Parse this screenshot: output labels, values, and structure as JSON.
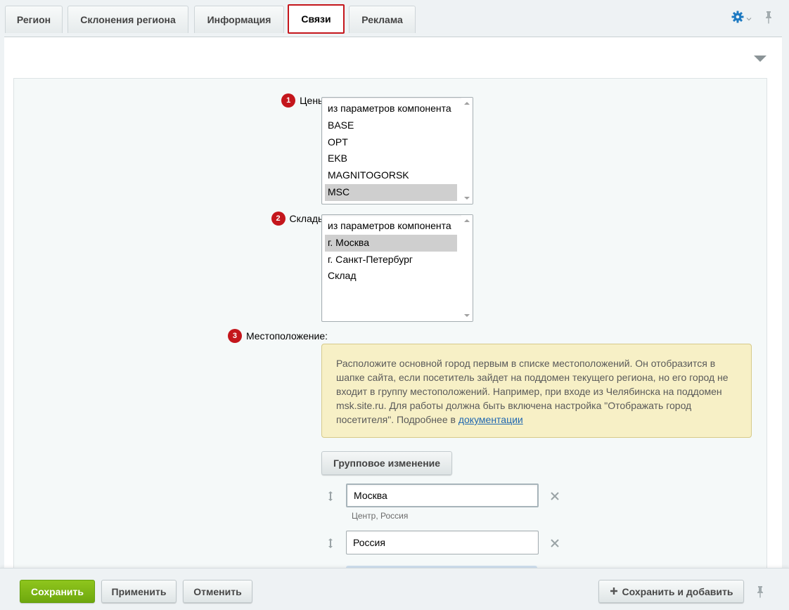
{
  "tabs": [
    {
      "label": "Регион"
    },
    {
      "label": "Склонения региона"
    },
    {
      "label": "Информация"
    },
    {
      "label": "Связи",
      "active": true
    },
    {
      "label": "Реклама"
    }
  ],
  "fields": {
    "prices": {
      "badge": "1",
      "label": "Цены:",
      "options": [
        "из параметров компонента",
        "BASE",
        "OPT",
        "EKB",
        "MAGNITOGORSK",
        "MSC"
      ],
      "selected": "MSC"
    },
    "warehouses": {
      "badge": "2",
      "label": "Склады:",
      "options": [
        "из параметров компонента",
        "г. Москва",
        "г. Санкт-Петербург",
        "Склад"
      ],
      "selected": "г. Москва"
    },
    "location": {
      "badge": "3",
      "label": "Местоположение:",
      "note_text": "Расположите основной город первым в списке местоположений. Он отобразится в шапке сайта, если посетитель зайдет на поддомен текущего региона, но его город не входит в группу местоположений. Например, при входе из Челябинска на поддомен msk.site.ru. Для работы должна быть включена настройка \"Отображать город посетителя\". Подробнее в ",
      "note_link": "документации",
      "group_change_label": "Групповое изменение",
      "items": [
        {
          "value": "Москва",
          "subtitle": "Центр, Россия"
        },
        {
          "value": "Россия",
          "subtitle": ""
        }
      ]
    }
  },
  "footer": {
    "save": "Сохранить",
    "apply": "Применить",
    "cancel": "Отменить",
    "save_add": "Сохранить и добавить"
  },
  "colors": {
    "accent_red": "#c4161c",
    "save_green": "#7ab615",
    "gear_blue": "#1e7ac2"
  },
  "icons": [
    "gear-icon",
    "pin-icon",
    "collapse-arrow-icon",
    "drag-handle-icon",
    "remove-icon",
    "plus-icon"
  ]
}
